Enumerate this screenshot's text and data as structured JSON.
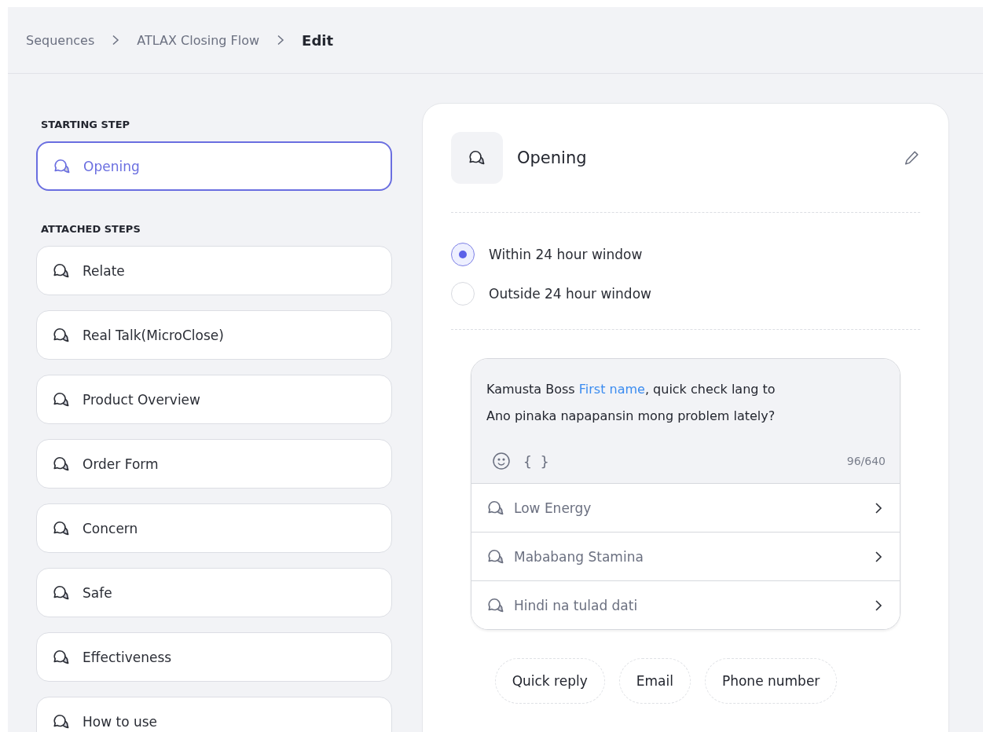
{
  "breadcrumb": [
    {
      "label": "Sequences",
      "current": false
    },
    {
      "label": "ATLAX Closing Flow",
      "current": false
    },
    {
      "label": "Edit",
      "current": true
    }
  ],
  "sidebar": {
    "starting_step": {
      "heading": "STARTING STEP",
      "items": [
        {
          "label": "Opening",
          "selected": true
        }
      ]
    },
    "attached_steps": {
      "heading": "ATTACHED STEPS",
      "items": [
        {
          "label": "Relate",
          "selected": false
        },
        {
          "label": "Real Talk(MicroClose)",
          "selected": false
        },
        {
          "label": "Product Overview",
          "selected": false
        },
        {
          "label": "Order Form",
          "selected": false
        },
        {
          "label": "Concern",
          "selected": false
        },
        {
          "label": "Safe",
          "selected": false
        },
        {
          "label": "Effectiveness",
          "selected": false
        },
        {
          "label": "How to use",
          "selected": false
        }
      ]
    }
  },
  "editor": {
    "title": "Opening",
    "window_options": [
      {
        "label": "Within 24 hour window",
        "selected": true
      },
      {
        "label": "Outside 24 hour window",
        "selected": false
      }
    ],
    "message": {
      "lines": [
        [
          {
            "kind": "text",
            "text": "Kamusta Boss "
          },
          {
            "kind": "variable",
            "text": "First name"
          },
          {
            "kind": "text",
            "text": ", quick check lang to"
          }
        ],
        [
          {
            "kind": "text",
            "text": "Ano pinaka napapansin mong problem lately?"
          }
        ]
      ],
      "variable_button": "{ }",
      "counter": "96/640"
    },
    "quick_replies": [
      {
        "label": "Low Energy"
      },
      {
        "label": "Mababang Stamina"
      },
      {
        "label": "Hindi na tulad dati"
      }
    ],
    "add_buttons": [
      "Quick reply",
      "Email",
      "Phone number"
    ]
  }
}
